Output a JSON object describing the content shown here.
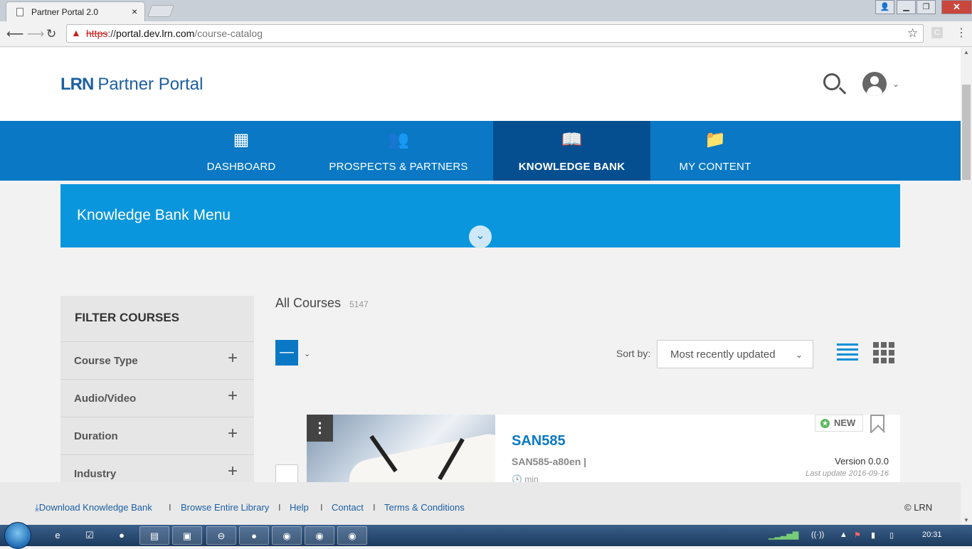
{
  "browser": {
    "tab_title": "Partner Portal 2.0",
    "tab_close": "×",
    "url_scheme": "https",
    "url_rest": "://",
    "url_host": "portal.dev.lrn.com",
    "url_path": "/course-catalog",
    "ext_label": "C",
    "window_controls": [
      "▭",
      "▭",
      "▣",
      "✕"
    ]
  },
  "header": {
    "logo_brand": "LRN",
    "logo_product": "Partner Portal"
  },
  "nav": [
    {
      "label": "DASHBOARD",
      "icon": "dashboard-icon",
      "active": false
    },
    {
      "label": "PROSPECTS & PARTNERS",
      "icon": "people-icon",
      "active": false
    },
    {
      "label": "KNOWLEDGE BANK",
      "icon": "book-icon",
      "active": true
    },
    {
      "label": "MY CONTENT",
      "icon": "folder-icon",
      "active": false
    }
  ],
  "kb_menu": {
    "title": "Knowledge Bank Menu"
  },
  "filter": {
    "title": "FILTER COURSES",
    "groups": [
      "Course Type",
      "Audio/Video",
      "Duration",
      "Industry"
    ]
  },
  "courses": {
    "heading": "All Courses",
    "count": "5147",
    "sort_label": "Sort by:",
    "sort_value": "Most recently updated"
  },
  "course_card": {
    "title": "SAN585",
    "code": "SAN585-a80en |",
    "duration": "min",
    "badge": "NEW",
    "version": "Version 0.0.0",
    "last_update": "Last update 2016-09-16"
  },
  "footer": {
    "links": [
      "Download Knowledge Bank",
      "Browse Entire Library",
      "Help",
      "Contact",
      "Terms & Conditions"
    ],
    "separator": "I",
    "copyright": "© LRN"
  },
  "taskbar": {
    "clock": "20:31"
  },
  "colors": {
    "brand_blue": "#0a78c4",
    "nav_active": "#054f91",
    "kb_menu": "#0a96dc"
  }
}
